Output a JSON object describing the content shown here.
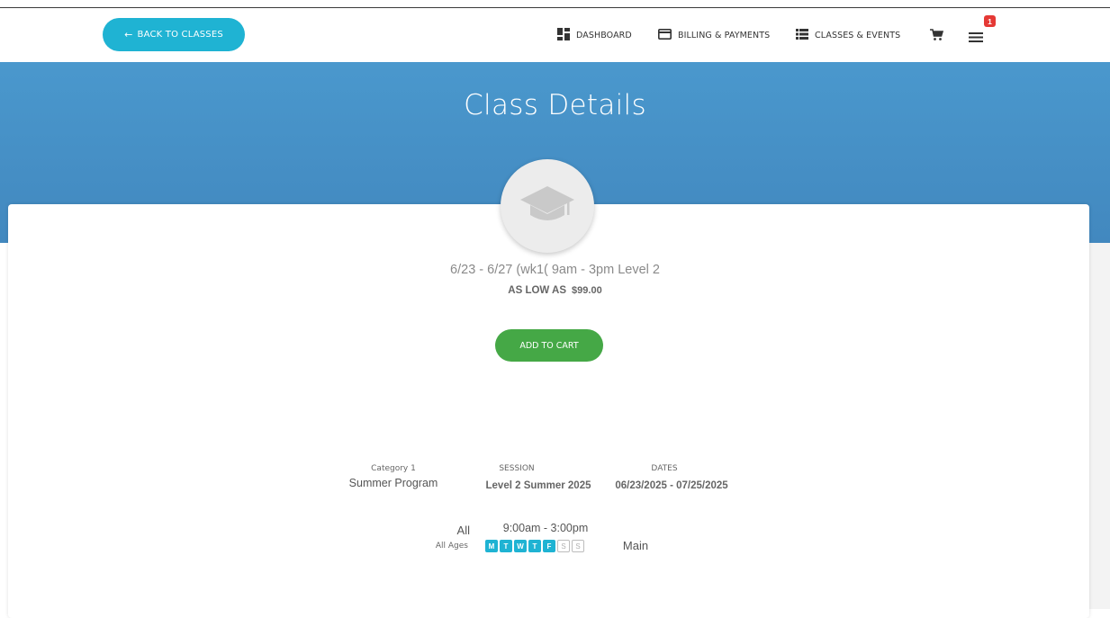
{
  "nav": {
    "back_label": "BACK TO CLASSES",
    "back_icon": "arrow-left-icon",
    "items": [
      {
        "label": "DASHBOARD",
        "icon": "dashboard-icon"
      },
      {
        "label": "BILLING & PAYMENTS",
        "icon": "credit-card-icon"
      },
      {
        "label": "CLASSES & EVENTS",
        "icon": "list-icon"
      }
    ],
    "cart_icon": "cart-icon",
    "menu_icon": "hamburger-menu-icon",
    "menu_badge": "1"
  },
  "hero": {
    "title": "Class Details"
  },
  "class": {
    "icon": "graduation-cap-icon",
    "title": "6/23 - 6/27 (wk1( 9am - 3pm Level 2",
    "price_label": "AS LOW AS",
    "price": "$99.00",
    "add_label": "ADD TO CART"
  },
  "details": {
    "category_label": "Category 1",
    "category_value": "Summer Program",
    "session_label": "SESSION",
    "session_value": "Level 2 Summer 2025",
    "dates_label": "DATES",
    "dates_value": "06/23/2025 - 07/25/2025",
    "age_value": "All",
    "age_label": "All Ages",
    "time": "9:00am - 3:00pm",
    "days": [
      {
        "letter": "M",
        "active": true
      },
      {
        "letter": "T",
        "active": true
      },
      {
        "letter": "W",
        "active": true
      },
      {
        "letter": "T",
        "active": true
      },
      {
        "letter": "F",
        "active": true
      },
      {
        "letter": "S",
        "active": false
      },
      {
        "letter": "S",
        "active": false
      }
    ],
    "location": "Main"
  },
  "colors": {
    "accent": "#1fb3d3",
    "hero_bg": "#4a98cd",
    "add_button": "#45a846",
    "badge": "#e53935"
  }
}
